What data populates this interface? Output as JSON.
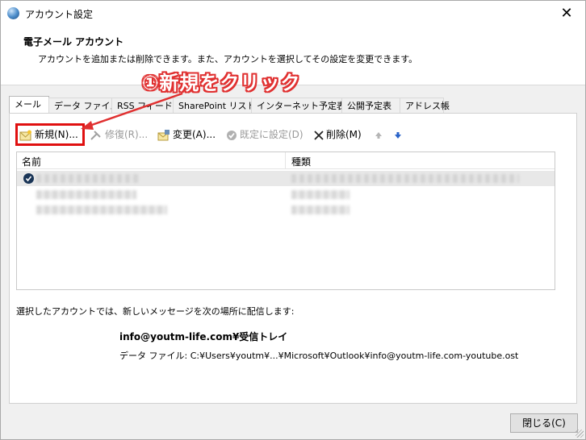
{
  "window": {
    "title": "アカウント設定"
  },
  "header": {
    "title": "電子メール アカウント",
    "description": "アカウントを追加または削除できます。また、アカウントを選択してその設定を変更できます。"
  },
  "annotation": {
    "text": "①新規をクリック",
    "color": "#e03030"
  },
  "tabs": [
    "メール",
    "データ ファイル",
    "RSS フィード",
    "SharePoint リスト",
    "インターネット予定表",
    "公開予定表",
    "アドレス帳"
  ],
  "toolbar": {
    "new_label": "新規(N)...",
    "repair_label": "修復(R)...",
    "change_label": "変更(A)...",
    "default_label": "既定に設定(D)",
    "delete_label": "削除(M)"
  },
  "accounts_list": {
    "columns": [
      "名前",
      "種類"
    ]
  },
  "footer": {
    "caption": "選択したアカウントでは、新しいメッセージを次の場所に配信します:",
    "inbox": "info@youtm-life.com¥受信トレイ",
    "data_file": "データ ファイル: C:¥Users¥youtm¥...¥Microsoft¥Outlook¥info@youtm-life.com-youtube.ost"
  },
  "buttons": {
    "close_label": "閉じる(C)"
  }
}
